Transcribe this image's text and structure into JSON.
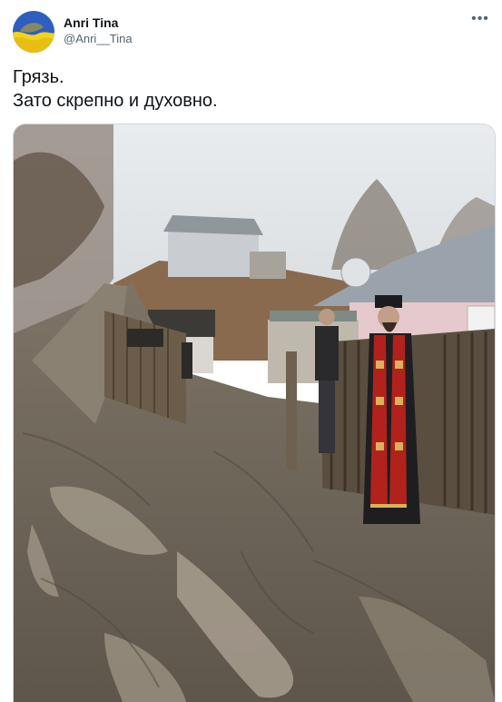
{
  "author": {
    "display_name": "Anri Tina",
    "handle": "@Anri__Tina",
    "avatar_icon": "ukraine-flag-avatar-icon"
  },
  "tweet": {
    "lines": [
      "Грязь.",
      "Зато скрепно и духовно."
    ]
  },
  "menu": {
    "icon": "more-options-icon",
    "glyph": "•••"
  },
  "media": {
    "type": "photo",
    "subject": "muddy village street with priest in red stole standing by wooden fence"
  },
  "colors": {
    "text": "#0f1419",
    "secondary": "#536471",
    "border": "#cfd9de",
    "flag_blue": "#1f5fbf",
    "flag_yellow": "#f3d21a"
  }
}
